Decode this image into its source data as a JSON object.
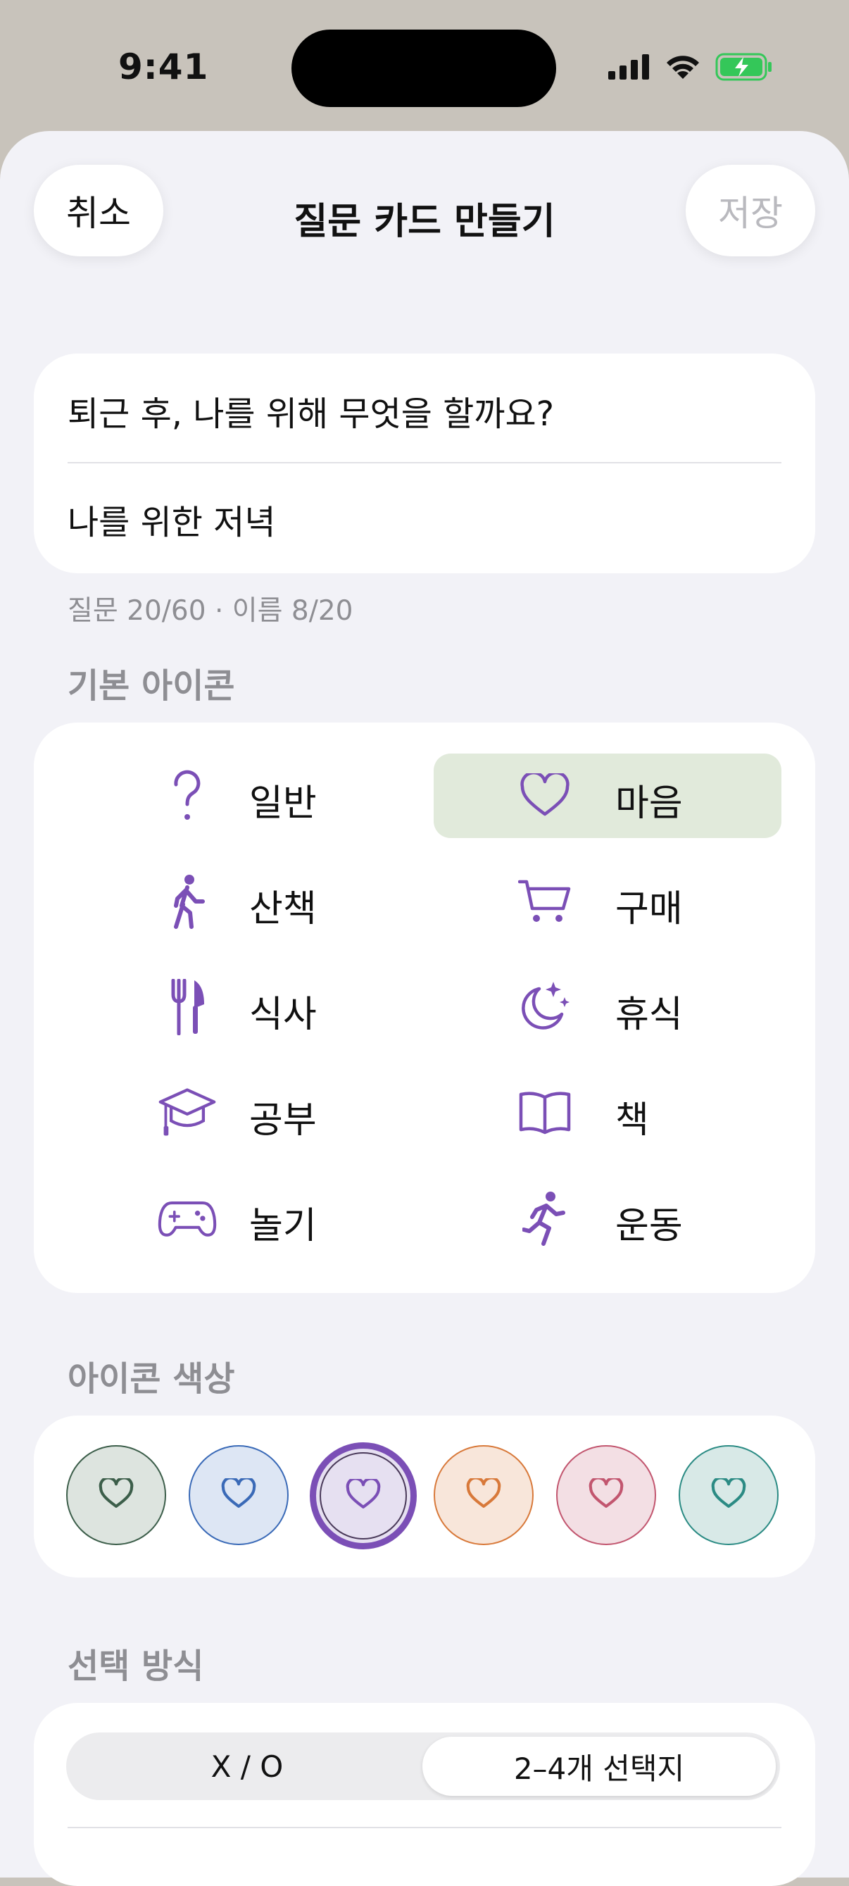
{
  "status_bar": {
    "time": "9:41"
  },
  "nav": {
    "cancel_label": "취소",
    "title": "질문 카드 만들기",
    "save_label": "저장"
  },
  "form": {
    "question_value": "퇴근 후, 나를 위해 무엇을 할까요?",
    "name_value": "나를 위한 저녁",
    "counter": "질문 20/60 · 이름 8/20"
  },
  "icons_section": {
    "label": "기본 아이콘",
    "items": [
      {
        "label": "일반",
        "icon": "question-icon"
      },
      {
        "label": "마음",
        "icon": "heart-icon",
        "selected": true
      },
      {
        "label": "산책",
        "icon": "walk-icon"
      },
      {
        "label": "구매",
        "icon": "cart-icon"
      },
      {
        "label": "식사",
        "icon": "fork-knife-icon"
      },
      {
        "label": "휴식",
        "icon": "moon-stars-icon"
      },
      {
        "label": "공부",
        "icon": "graduation-cap-icon"
      },
      {
        "label": "책",
        "icon": "book-icon"
      },
      {
        "label": "놀기",
        "icon": "gamepad-icon"
      },
      {
        "label": "운동",
        "icon": "run-icon"
      }
    ]
  },
  "color_section": {
    "label": "아이콘 색상",
    "swatches": [
      {
        "name": "green",
        "fill": "#dde4df",
        "stroke": "#3c5e4a"
      },
      {
        "name": "blue",
        "fill": "#dde6f4",
        "stroke": "#3a6ab7"
      },
      {
        "name": "purple",
        "fill": "#e6e0f1",
        "stroke": "#7b4fb6",
        "selected": true
      },
      {
        "name": "orange",
        "fill": "#f8e6da",
        "stroke": "#d8793a"
      },
      {
        "name": "pink",
        "fill": "#f3dfe4",
        "stroke": "#c2566f"
      },
      {
        "name": "teal",
        "fill": "#d8e9e7",
        "stroke": "#2b8b84"
      }
    ]
  },
  "choice_section": {
    "label": "선택 방식",
    "options": [
      "X / O",
      "2–4개 선택지"
    ],
    "selected_index": 1
  },
  "colors": {
    "accent": "#7b4fb6",
    "selected_bg": "#e1eadb",
    "sheet_bg": "#f2f2f7"
  }
}
